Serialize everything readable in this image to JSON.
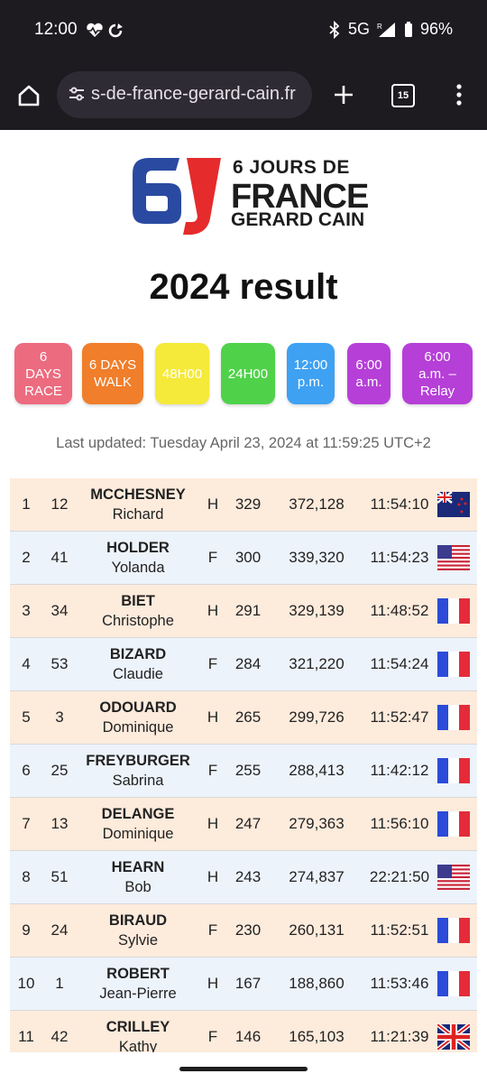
{
  "status": {
    "time": "12:00",
    "network": "5G",
    "battery": "96%"
  },
  "browser": {
    "url": "s-de-france-gerard-cain.fr",
    "tab_count": "15"
  },
  "logo": {
    "line1": "6 JOURS DE",
    "line2": "FRANCE",
    "line3": "GERARD CAIN"
  },
  "page_title": "2024 result",
  "filters": [
    {
      "label": "6 DAYS RACE",
      "color": "#ec6b7f"
    },
    {
      "label": "6 DAYS WALK",
      "color": "#f07e2a"
    },
    {
      "label": "48H00",
      "color": "#f5e93a"
    },
    {
      "label": "24H00",
      "color": "#4fd24a"
    },
    {
      "label": "12:00 p.m.",
      "color": "#3ea1f2"
    },
    {
      "label": "6:00 a.m.",
      "color": "#b63fd8"
    },
    {
      "label": "6:00 a.m. – Relay",
      "color": "#b63fd8"
    }
  ],
  "last_updated": "Last updated: Tuesday April 23, 2024 at 11:59:25 UTC+2",
  "results": [
    {
      "rank": "1",
      "bib": "12",
      "last": "MCCHESNEY",
      "first": "Richard",
      "sex": "H",
      "laps": "329",
      "distance": "372,128",
      "time": "11:54:10",
      "flag": "nz"
    },
    {
      "rank": "2",
      "bib": "41",
      "last": "HOLDER",
      "first": "Yolanda",
      "sex": "F",
      "laps": "300",
      "distance": "339,320",
      "time": "11:54:23",
      "flag": "us"
    },
    {
      "rank": "3",
      "bib": "34",
      "last": "BIET",
      "first": "Christophe",
      "sex": "H",
      "laps": "291",
      "distance": "329,139",
      "time": "11:48:52",
      "flag": "fr"
    },
    {
      "rank": "4",
      "bib": "53",
      "last": "BIZARD",
      "first": "Claudie",
      "sex": "F",
      "laps": "284",
      "distance": "321,220",
      "time": "11:54:24",
      "flag": "fr"
    },
    {
      "rank": "5",
      "bib": "3",
      "last": "ODOUARD",
      "first": "Dominique",
      "sex": "H",
      "laps": "265",
      "distance": "299,726",
      "time": "11:52:47",
      "flag": "fr"
    },
    {
      "rank": "6",
      "bib": "25",
      "last": "FREYBURGER",
      "first": "Sabrina",
      "sex": "F",
      "laps": "255",
      "distance": "288,413",
      "time": "11:42:12",
      "flag": "fr"
    },
    {
      "rank": "7",
      "bib": "13",
      "last": "DELANGE",
      "first": "Dominique",
      "sex": "H",
      "laps": "247",
      "distance": "279,363",
      "time": "11:56:10",
      "flag": "fr"
    },
    {
      "rank": "8",
      "bib": "51",
      "last": "HEARN",
      "first": "Bob",
      "sex": "H",
      "laps": "243",
      "distance": "274,837",
      "time": "22:21:50",
      "flag": "us"
    },
    {
      "rank": "9",
      "bib": "24",
      "last": "BIRAUD",
      "first": "Sylvie",
      "sex": "F",
      "laps": "230",
      "distance": "260,131",
      "time": "11:52:51",
      "flag": "fr"
    },
    {
      "rank": "10",
      "bib": "1",
      "last": "ROBERT",
      "first": "Jean-Pierre",
      "sex": "H",
      "laps": "167",
      "distance": "188,860",
      "time": "11:53:46",
      "flag": "fr"
    },
    {
      "rank": "11",
      "bib": "42",
      "last": "CRILLEY",
      "first": "Kathy",
      "sex": "F",
      "laps": "146",
      "distance": "165,103",
      "time": "11:21:39",
      "flag": "gb"
    }
  ]
}
